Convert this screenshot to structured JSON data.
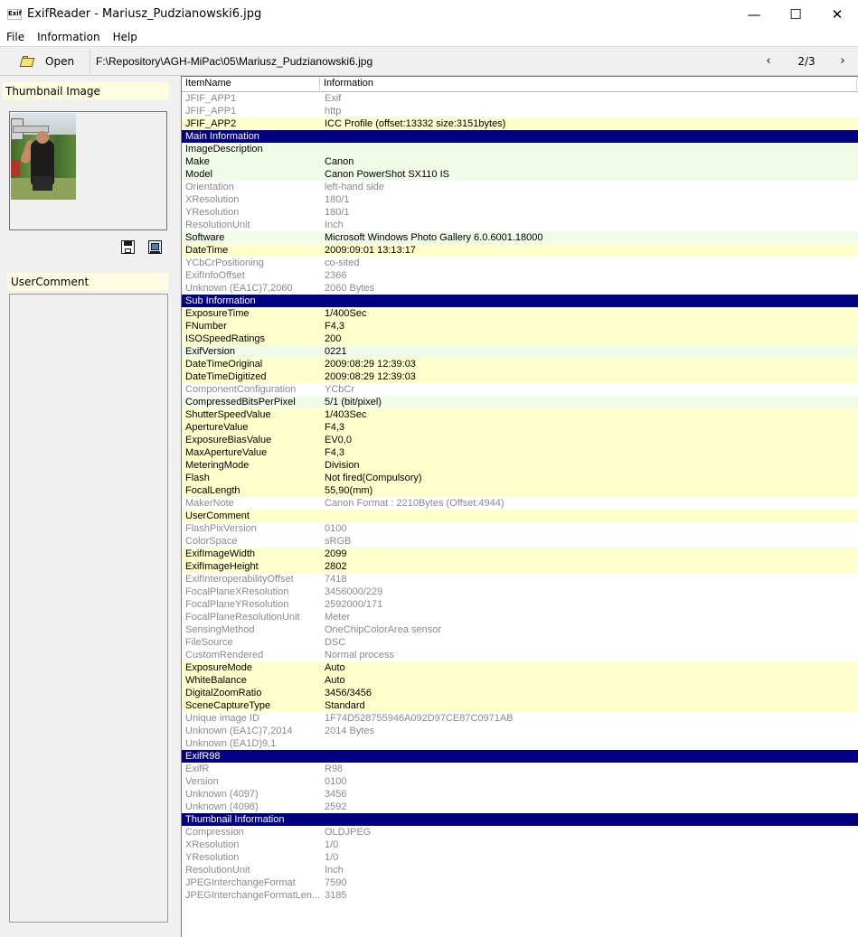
{
  "window": {
    "app_icon_text": "Exif",
    "title": "ExifReader - Mariusz_Pudzianowski6.jpg",
    "minimize": "—",
    "maximize": "☐",
    "close": "✕"
  },
  "menu": [
    "File",
    "Information",
    "Help"
  ],
  "toolbar": {
    "open_label": "Open",
    "path": "F:\\Repository\\AGH-MiPac\\05\\Mariusz_Pudzianowski6.jpg",
    "prev": "‹",
    "page": "2/3",
    "next": "›"
  },
  "left_panel": {
    "thumbnail_header": "Thumbnail Image",
    "usercomment_header": "UserComment"
  },
  "table": {
    "columns": [
      "ItemName",
      "Information"
    ],
    "rows": [
      {
        "name": "JFIF_APP1",
        "value": "Exif",
        "style": "w"
      },
      {
        "name": "JFIF_APP1",
        "value": "http",
        "style": "w"
      },
      {
        "name": "JFIF_APP2",
        "value": "ICC Profile (offset:13332 size:3151bytes)",
        "style": "y"
      },
      {
        "name": "Main Information",
        "value": "",
        "style": "h"
      },
      {
        "name": "ImageDescription",
        "value": "",
        "style": "g"
      },
      {
        "name": "Make",
        "value": "Canon",
        "style": "g"
      },
      {
        "name": "Model",
        "value": "Canon PowerShot SX110 IS",
        "style": "g"
      },
      {
        "name": "Orientation",
        "value": "left-hand side",
        "style": "w"
      },
      {
        "name": "XResolution",
        "value": "180/1",
        "style": "w"
      },
      {
        "name": "YResolution",
        "value": "180/1",
        "style": "w"
      },
      {
        "name": "ResolutionUnit",
        "value": "Inch",
        "style": "w"
      },
      {
        "name": "Software",
        "value": "Microsoft Windows Photo Gallery 6.0.6001.18000",
        "style": "g"
      },
      {
        "name": "DateTime",
        "value": "2009:09:01 13:13:17",
        "style": "y"
      },
      {
        "name": "YCbCrPositioning",
        "value": "co-sited",
        "style": "w"
      },
      {
        "name": "ExifInfoOffset",
        "value": "2366",
        "style": "w"
      },
      {
        "name": "Unknown (EA1C)7,2060",
        "value": "2060 Bytes",
        "style": "w"
      },
      {
        "name": "Sub Information",
        "value": "",
        "style": "h"
      },
      {
        "name": "ExposureTime",
        "value": "1/400Sec",
        "style": "y"
      },
      {
        "name": "FNumber",
        "value": "F4,3",
        "style": "y"
      },
      {
        "name": "ISOSpeedRatings",
        "value": "200",
        "style": "y"
      },
      {
        "name": "ExifVersion",
        "value": "0221",
        "style": "g"
      },
      {
        "name": "DateTimeOriginal",
        "value": "2009:08:29 12:39:03",
        "style": "y"
      },
      {
        "name": "DateTimeDigitized",
        "value": "2009:08:29 12:39:03",
        "style": "y"
      },
      {
        "name": "ComponentConfiguration",
        "value": "YCbCr",
        "style": "w"
      },
      {
        "name": "CompressedBitsPerPixel",
        "value": "5/1 (bit/pixel)",
        "style": "g"
      },
      {
        "name": "ShutterSpeedValue",
        "value": "1/403Sec",
        "style": "y"
      },
      {
        "name": "ApertureValue",
        "value": "F4,3",
        "style": "y"
      },
      {
        "name": "ExposureBiasValue",
        "value": "EV0,0",
        "style": "y"
      },
      {
        "name": "MaxApertureValue",
        "value": "F4,3",
        "style": "y"
      },
      {
        "name": "MeteringMode",
        "value": "Division",
        "style": "y"
      },
      {
        "name": "Flash",
        "value": "Not fired(Compulsory)",
        "style": "y"
      },
      {
        "name": "FocalLength",
        "value": "55,90(mm)",
        "style": "y"
      },
      {
        "name": "MakerNote",
        "value": "Canon Format : 2210Bytes (Offset:4944)",
        "style": "w"
      },
      {
        "name": "UserComment",
        "value": "",
        "style": "y"
      },
      {
        "name": "FlashPixVersion",
        "value": "0100",
        "style": "w"
      },
      {
        "name": "ColorSpace",
        "value": "sRGB",
        "style": "w"
      },
      {
        "name": "ExifImageWidth",
        "value": "2099",
        "style": "y"
      },
      {
        "name": "ExifImageHeight",
        "value": "2802",
        "style": "y"
      },
      {
        "name": "ExifInteroperabilityOffset",
        "value": "7418",
        "style": "w"
      },
      {
        "name": "FocalPlaneXResolution",
        "value": "3456000/229",
        "style": "w"
      },
      {
        "name": "FocalPlaneYResolution",
        "value": "2592000/171",
        "style": "w"
      },
      {
        "name": "FocalPlaneResolutionUnit",
        "value": "Meter",
        "style": "w"
      },
      {
        "name": "SensingMethod",
        "value": "OneChipColorArea sensor",
        "style": "w"
      },
      {
        "name": "FileSource",
        "value": "DSC",
        "style": "w"
      },
      {
        "name": "CustomRendered",
        "value": "Normal process",
        "style": "w"
      },
      {
        "name": "ExposureMode",
        "value": "Auto",
        "style": "y"
      },
      {
        "name": "WhiteBalance",
        "value": "Auto",
        "style": "y"
      },
      {
        "name": "DigitalZoomRatio",
        "value": "3456/3456",
        "style": "y"
      },
      {
        "name": "SceneCaptureType",
        "value": "Standard",
        "style": "y"
      },
      {
        "name": "Unique image ID",
        "value": "1F74D528755946A092D97CE87C0971AB",
        "style": "w"
      },
      {
        "name": "Unknown (EA1C)7,2014",
        "value": "2014 Bytes",
        "style": "w"
      },
      {
        "name": "Unknown (EA1D)9,1",
        "value": "",
        "style": "w"
      },
      {
        "name": "ExifR98",
        "value": "",
        "style": "h"
      },
      {
        "name": "ExifR",
        "value": "R98",
        "style": "w"
      },
      {
        "name": "Version",
        "value": "0100",
        "style": "w"
      },
      {
        "name": "Unknown (4097)",
        "value": "3456",
        "style": "w"
      },
      {
        "name": "Unknown (4098)",
        "value": "2592",
        "style": "w"
      },
      {
        "name": "Thumbnail Information",
        "value": "",
        "style": "h"
      },
      {
        "name": "Compression",
        "value": "OLDJPEG",
        "style": "w"
      },
      {
        "name": "XResolution",
        "value": "1/0",
        "style": "w"
      },
      {
        "name": "YResolution",
        "value": "1/0",
        "style": "w"
      },
      {
        "name": "ResolutionUnit",
        "value": "Inch",
        "style": "w"
      },
      {
        "name": "JPEGInterchangeFormat",
        "value": "7590",
        "style": "w"
      },
      {
        "name": "JPEGInterchangeFormatLen...",
        "value": "3185",
        "style": "w"
      }
    ]
  }
}
